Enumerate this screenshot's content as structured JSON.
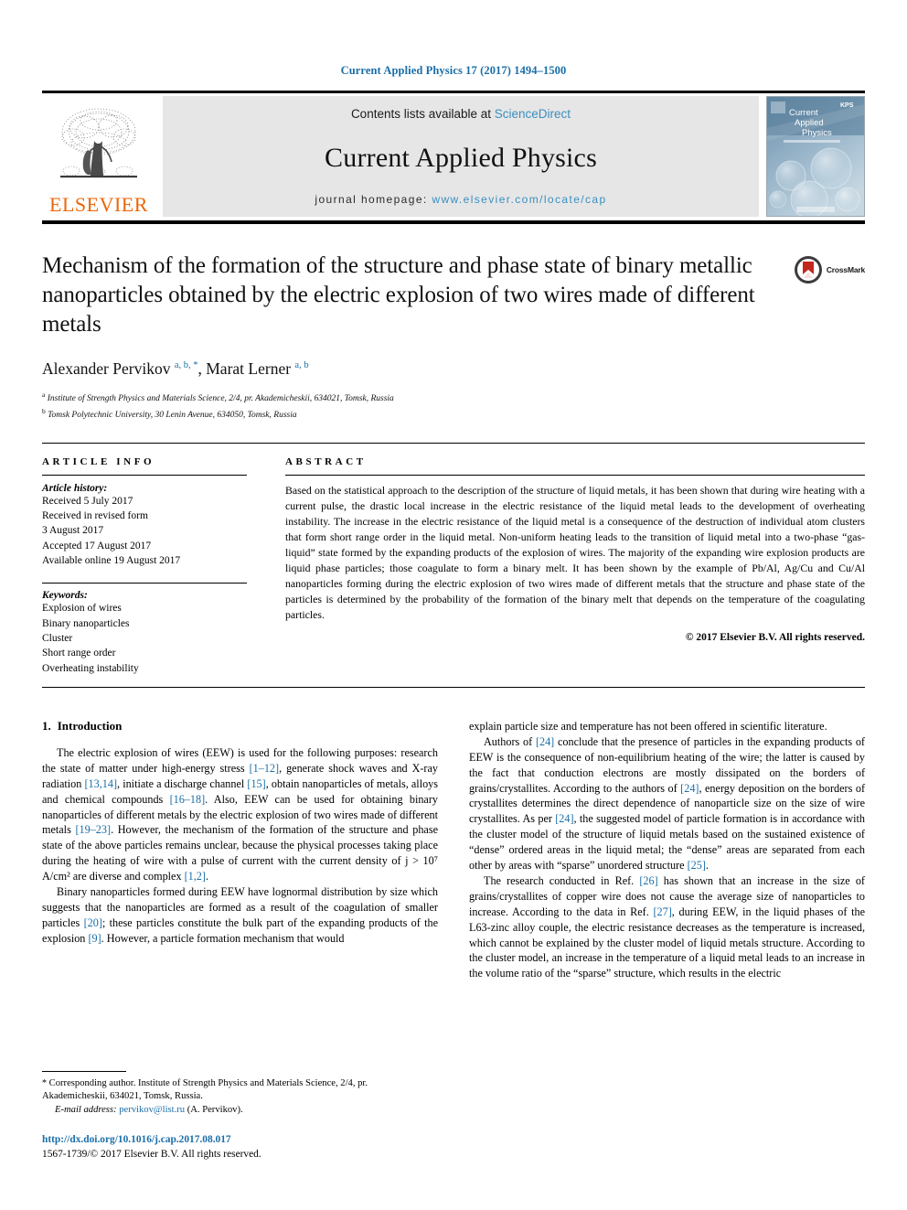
{
  "running_head": "Current Applied Physics 17 (2017) 1494–1500",
  "masthead": {
    "publisher_name": "ELSEVIER",
    "contents_prefix": "Contents lists available at ",
    "contents_link": "ScienceDirect",
    "journal_name": "Current Applied Physics",
    "homepage_prefix": "journal homepage: ",
    "homepage_url": "www.elsevier.com/locate/cap",
    "cover_title_line1": "Current",
    "cover_title_line2": "Applied",
    "cover_title_line3": "Physics",
    "cover_badge": "KPS",
    "colors": {
      "elsevier_orange": "#ec6608",
      "link_blue": "#1a6ea8",
      "banner_gray": "#e6e6e6"
    }
  },
  "article": {
    "title": "Mechanism of the formation of the structure and phase state of binary metallic nanoparticles obtained by the electric explosion of two wires made of different metals",
    "crossmark_label": "CrossMark",
    "authors_html": "Alexander Pervikov <sup>a, b, *</sup>, Marat Lerner <sup>a, b</sup>",
    "affiliations": [
      {
        "marker": "a",
        "text": "Institute of Strength Physics and Materials Science, 2/4, pr. Akademicheskii, 634021, Tomsk, Russia"
      },
      {
        "marker": "b",
        "text": "Tomsk Polytechnic University, 30 Lenin Avenue, 634050, Tomsk, Russia"
      }
    ]
  },
  "article_info": {
    "heading": "ARTICLE INFO",
    "history_label": "Article history:",
    "history": [
      "Received 5 July 2017",
      "Received in revised form",
      "3 August 2017",
      "Accepted 17 August 2017",
      "Available online 19 August 2017"
    ],
    "keywords_label": "Keywords:",
    "keywords": [
      "Explosion of wires",
      "Binary nanoparticles",
      "Cluster",
      "Short range order",
      "Overheating instability"
    ]
  },
  "abstract": {
    "heading": "ABSTRACT",
    "text": "Based on the statistical approach to the description of the structure of liquid metals, it has been shown that during wire heating with a current pulse, the drastic local increase in the electric resistance of the liquid metal leads to the development of overheating instability. The increase in the electric resistance of the liquid metal is a consequence of the destruction of individual atom clusters that form short range order in the liquid metal. Non-uniform heating leads to the transition of liquid metal into a two-phase “gas-liquid” state formed by the expanding products of the explosion of wires. The majority of the expanding wire explosion products are liquid phase particles; those coagulate to form a binary melt. It has been shown by the example of Pb/Al, Ag/Cu and Cu/Al nanoparticles forming during the electric explosion of two wires made of different metals that the structure and phase state of the particles is determined by the probability of the formation of the binary melt that depends on the temperature of the coagulating particles.",
    "copyright": "© 2017 Elsevier B.V. All rights reserved."
  },
  "body": {
    "section_number": "1.",
    "section_title": "Introduction",
    "left_paragraphs": [
      {
        "parts": [
          {
            "t": "The electric explosion of wires (EEW) is used for the following purposes: research the state of matter under high-energy stress "
          },
          {
            "t": "[1–12]",
            "ref": true
          },
          {
            "t": ", generate shock waves and X-ray radiation "
          },
          {
            "t": "[13,14]",
            "ref": true
          },
          {
            "t": ", initiate a discharge channel "
          },
          {
            "t": "[15]",
            "ref": true
          },
          {
            "t": ", obtain nanoparticles of metals, alloys and chemical compounds "
          },
          {
            "t": "[16–18]",
            "ref": true
          },
          {
            "t": ". Also, EEW can be used for obtaining binary nanoparticles of different metals by the electric explosion of two wires made of different metals "
          },
          {
            "t": "[19–23]",
            "ref": true
          },
          {
            "t": ". However, the mechanism of the formation of the structure and phase state of the above particles remains unclear, because the physical processes taking place during the heating of wire with a pulse of current with the current density of j > 10⁷ A/cm² are diverse and complex "
          },
          {
            "t": "[1,2]",
            "ref": true
          },
          {
            "t": "."
          }
        ]
      },
      {
        "parts": [
          {
            "t": "Binary nanoparticles formed during EEW have lognormal distribution by size which suggests that the nanoparticles are formed as a result of the coagulation of smaller particles "
          },
          {
            "t": "[20]",
            "ref": true
          },
          {
            "t": "; these particles constitute the bulk part of the expanding products of the explosion "
          },
          {
            "t": "[9]",
            "ref": true
          },
          {
            "t": ". However, a particle formation mechanism that would"
          }
        ]
      }
    ],
    "right_paragraphs": [
      {
        "indent": false,
        "parts": [
          {
            "t": "explain particle size and temperature has not been offered in scientific literature."
          }
        ]
      },
      {
        "indent": true,
        "parts": [
          {
            "t": "Authors of "
          },
          {
            "t": "[24]",
            "ref": true
          },
          {
            "t": " conclude that the presence of particles in the expanding products of EEW is the consequence of non-equilibrium heating of the wire; the latter is caused by the fact that conduction electrons are mostly dissipated on the borders of grains/crystallites. According to the authors of "
          },
          {
            "t": "[24]",
            "ref": true
          },
          {
            "t": ", energy deposition on the borders of crystallites determines the direct dependence of nanoparticle size on the size of wire crystallites. As per "
          },
          {
            "t": "[24]",
            "ref": true
          },
          {
            "t": ", the suggested model of particle formation is in accordance with the cluster model of the structure of liquid metals based on the sustained existence of “dense” ordered areas in the liquid metal; the “dense” areas are separated from each other by areas with “sparse” unordered structure "
          },
          {
            "t": "[25]",
            "ref": true
          },
          {
            "t": "."
          }
        ]
      },
      {
        "indent": true,
        "parts": [
          {
            "t": "The research conducted in Ref. "
          },
          {
            "t": "[26]",
            "ref": true
          },
          {
            "t": " has shown that an increase in the size of grains/crystallites of copper wire does not cause the average size of nanoparticles to increase. According to the data in Ref. "
          },
          {
            "t": "[27]",
            "ref": true
          },
          {
            "t": ", during EEW, in the liquid phases of the L63-zinc alloy couple, the electric resistance decreases as the temperature is increased, which cannot be explained by the cluster model of liquid metals structure. According to the cluster model, an increase in the temperature of a liquid metal leads to an increase in the volume ratio of the “sparse” structure, which results in the electric"
          }
        ]
      }
    ]
  },
  "footnote": {
    "star": "*",
    "corresponding": " Corresponding author. Institute of Strength Physics and Materials Science, 2/4, pr. Akademicheskii, 634021, Tomsk, Russia.",
    "email_label": "E-mail address:",
    "email": "pervikov@list.ru",
    "email_suffix": " (A. Pervikov).",
    "doi": "http://dx.doi.org/10.1016/j.cap.2017.08.017",
    "issn": "1567-1739/© 2017 Elsevier B.V. All rights reserved."
  }
}
